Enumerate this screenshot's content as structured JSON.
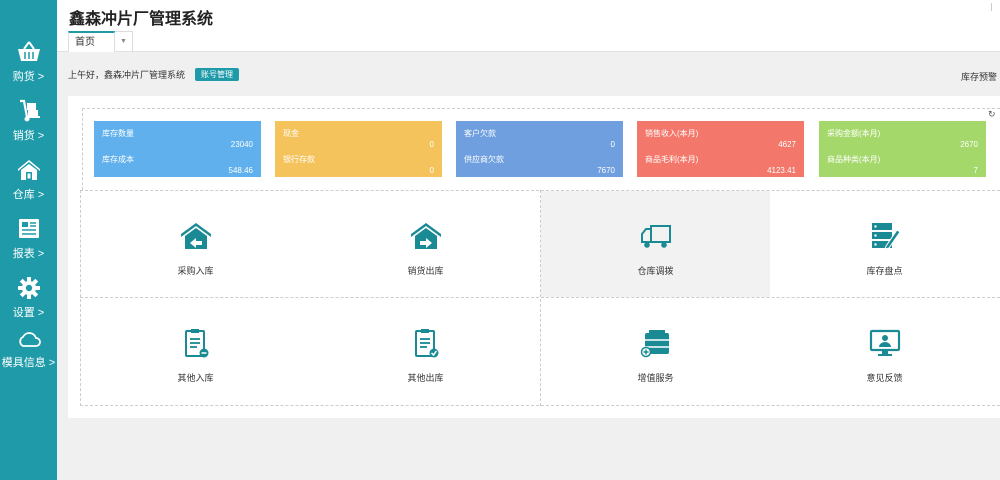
{
  "app": {
    "title": "鑫森冲片厂管理系统"
  },
  "tabs": {
    "home": "首页",
    "dropdown_icon": "caret-down-icon"
  },
  "sidebar": {
    "items": [
      {
        "label": "购货 >",
        "icon": "basket-icon"
      },
      {
        "label": "销货 >",
        "icon": "hand-truck-icon"
      },
      {
        "label": "仓库 >",
        "icon": "warehouse-icon"
      },
      {
        "label": "报表 >",
        "icon": "report-icon"
      },
      {
        "label": "设置 >",
        "icon": "gear-icon"
      },
      {
        "label": "模具信息 >",
        "icon": "cloud-icon"
      }
    ]
  },
  "greeting": {
    "text": "上午好，鑫森冲片厂管理系统",
    "badge": "账号管理"
  },
  "stock_warning": "库存预警",
  "stats": [
    {
      "label1": "库存数量",
      "value1": "23040",
      "label2": "库存成本",
      "value2": "548.46",
      "color": "#5fb0ec"
    },
    {
      "label1": "现金",
      "value1": "0",
      "label2": "银行存款",
      "value2": "0",
      "color": "#f5c35c"
    },
    {
      "label1": "客户欠款",
      "value1": "0",
      "label2": "供应商欠款",
      "value2": "7670",
      "color": "#6f9fde"
    },
    {
      "label1": "销售收入(本月)",
      "value1": "4627",
      "label2": "商品毛利(本月)",
      "value2": "4123.41",
      "color": "#f3776a"
    },
    {
      "label1": "采购金额(本月)",
      "value1": "2670",
      "label2": "商品种类(本月)",
      "value2": "7",
      "color": "#a5d86a"
    }
  ],
  "tiles": [
    {
      "label": "采购入库",
      "icon": "warehouse-in-icon"
    },
    {
      "label": "销货出库",
      "icon": "warehouse-out-icon"
    },
    {
      "label": "仓库调拨",
      "icon": "truck-icon"
    },
    {
      "label": "库存盘点",
      "icon": "inventory-check-icon"
    },
    {
      "label": "其他入库",
      "icon": "clipboard-in-icon"
    },
    {
      "label": "其他出库",
      "icon": "clipboard-out-icon"
    },
    {
      "label": "增值服务",
      "icon": "toolbox-icon"
    },
    {
      "label": "意见反馈",
      "icon": "monitor-user-icon"
    }
  ],
  "colors": {
    "accent": "#1e9aa8",
    "sidebar": "#1e9aa8",
    "icon": "#1a8a94"
  }
}
